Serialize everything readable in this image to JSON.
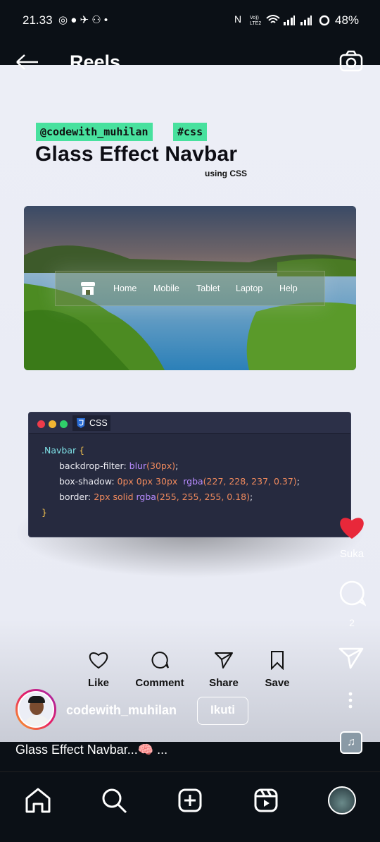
{
  "status": {
    "time": "21.33",
    "battery": "48%",
    "network": "Vo)) LTE2"
  },
  "nav": {
    "title": "Reels"
  },
  "reel": {
    "tags": [
      "@codewith_muhilan",
      "#css"
    ],
    "title": "Glass Effect Navbar",
    "subtitle": "using CSS",
    "demo_nav": [
      "Home",
      "Mobile",
      "Tablet",
      "Laptop",
      "Help"
    ],
    "code": {
      "tab": "CSS",
      "l1_sel": ".Navbar",
      "l1_brace": "{",
      "l2_prop": "backdrop-filter: ",
      "l2_fn": "blur",
      "l2_val": "(30px)",
      "l2_end": ";",
      "l3_prop": "box-shadow: ",
      "l3_val": "0px 0px 30px  ",
      "l3_fn": "rgba",
      "l3_args": "(227, 228, 237, 0.37)",
      "l3_end": ";",
      "l4_prop": "border: ",
      "l4_val": "2px solid ",
      "l4_fn": "rgba",
      "l4_args": "(255, 255, 255, 0.18)",
      "l4_end": ";",
      "l5": "}"
    },
    "actions": [
      "Like",
      "Comment",
      "Share",
      "Save"
    ]
  },
  "rail": {
    "like_label": "Suka",
    "comment_count": "2"
  },
  "author": {
    "name": "codewith_muhilan",
    "follow": "Ikuti"
  },
  "caption": "Glass Effect Navbar...🧠 ...",
  "colors": {
    "accent_tag": "#48e19e",
    "like": "#e8283a"
  }
}
